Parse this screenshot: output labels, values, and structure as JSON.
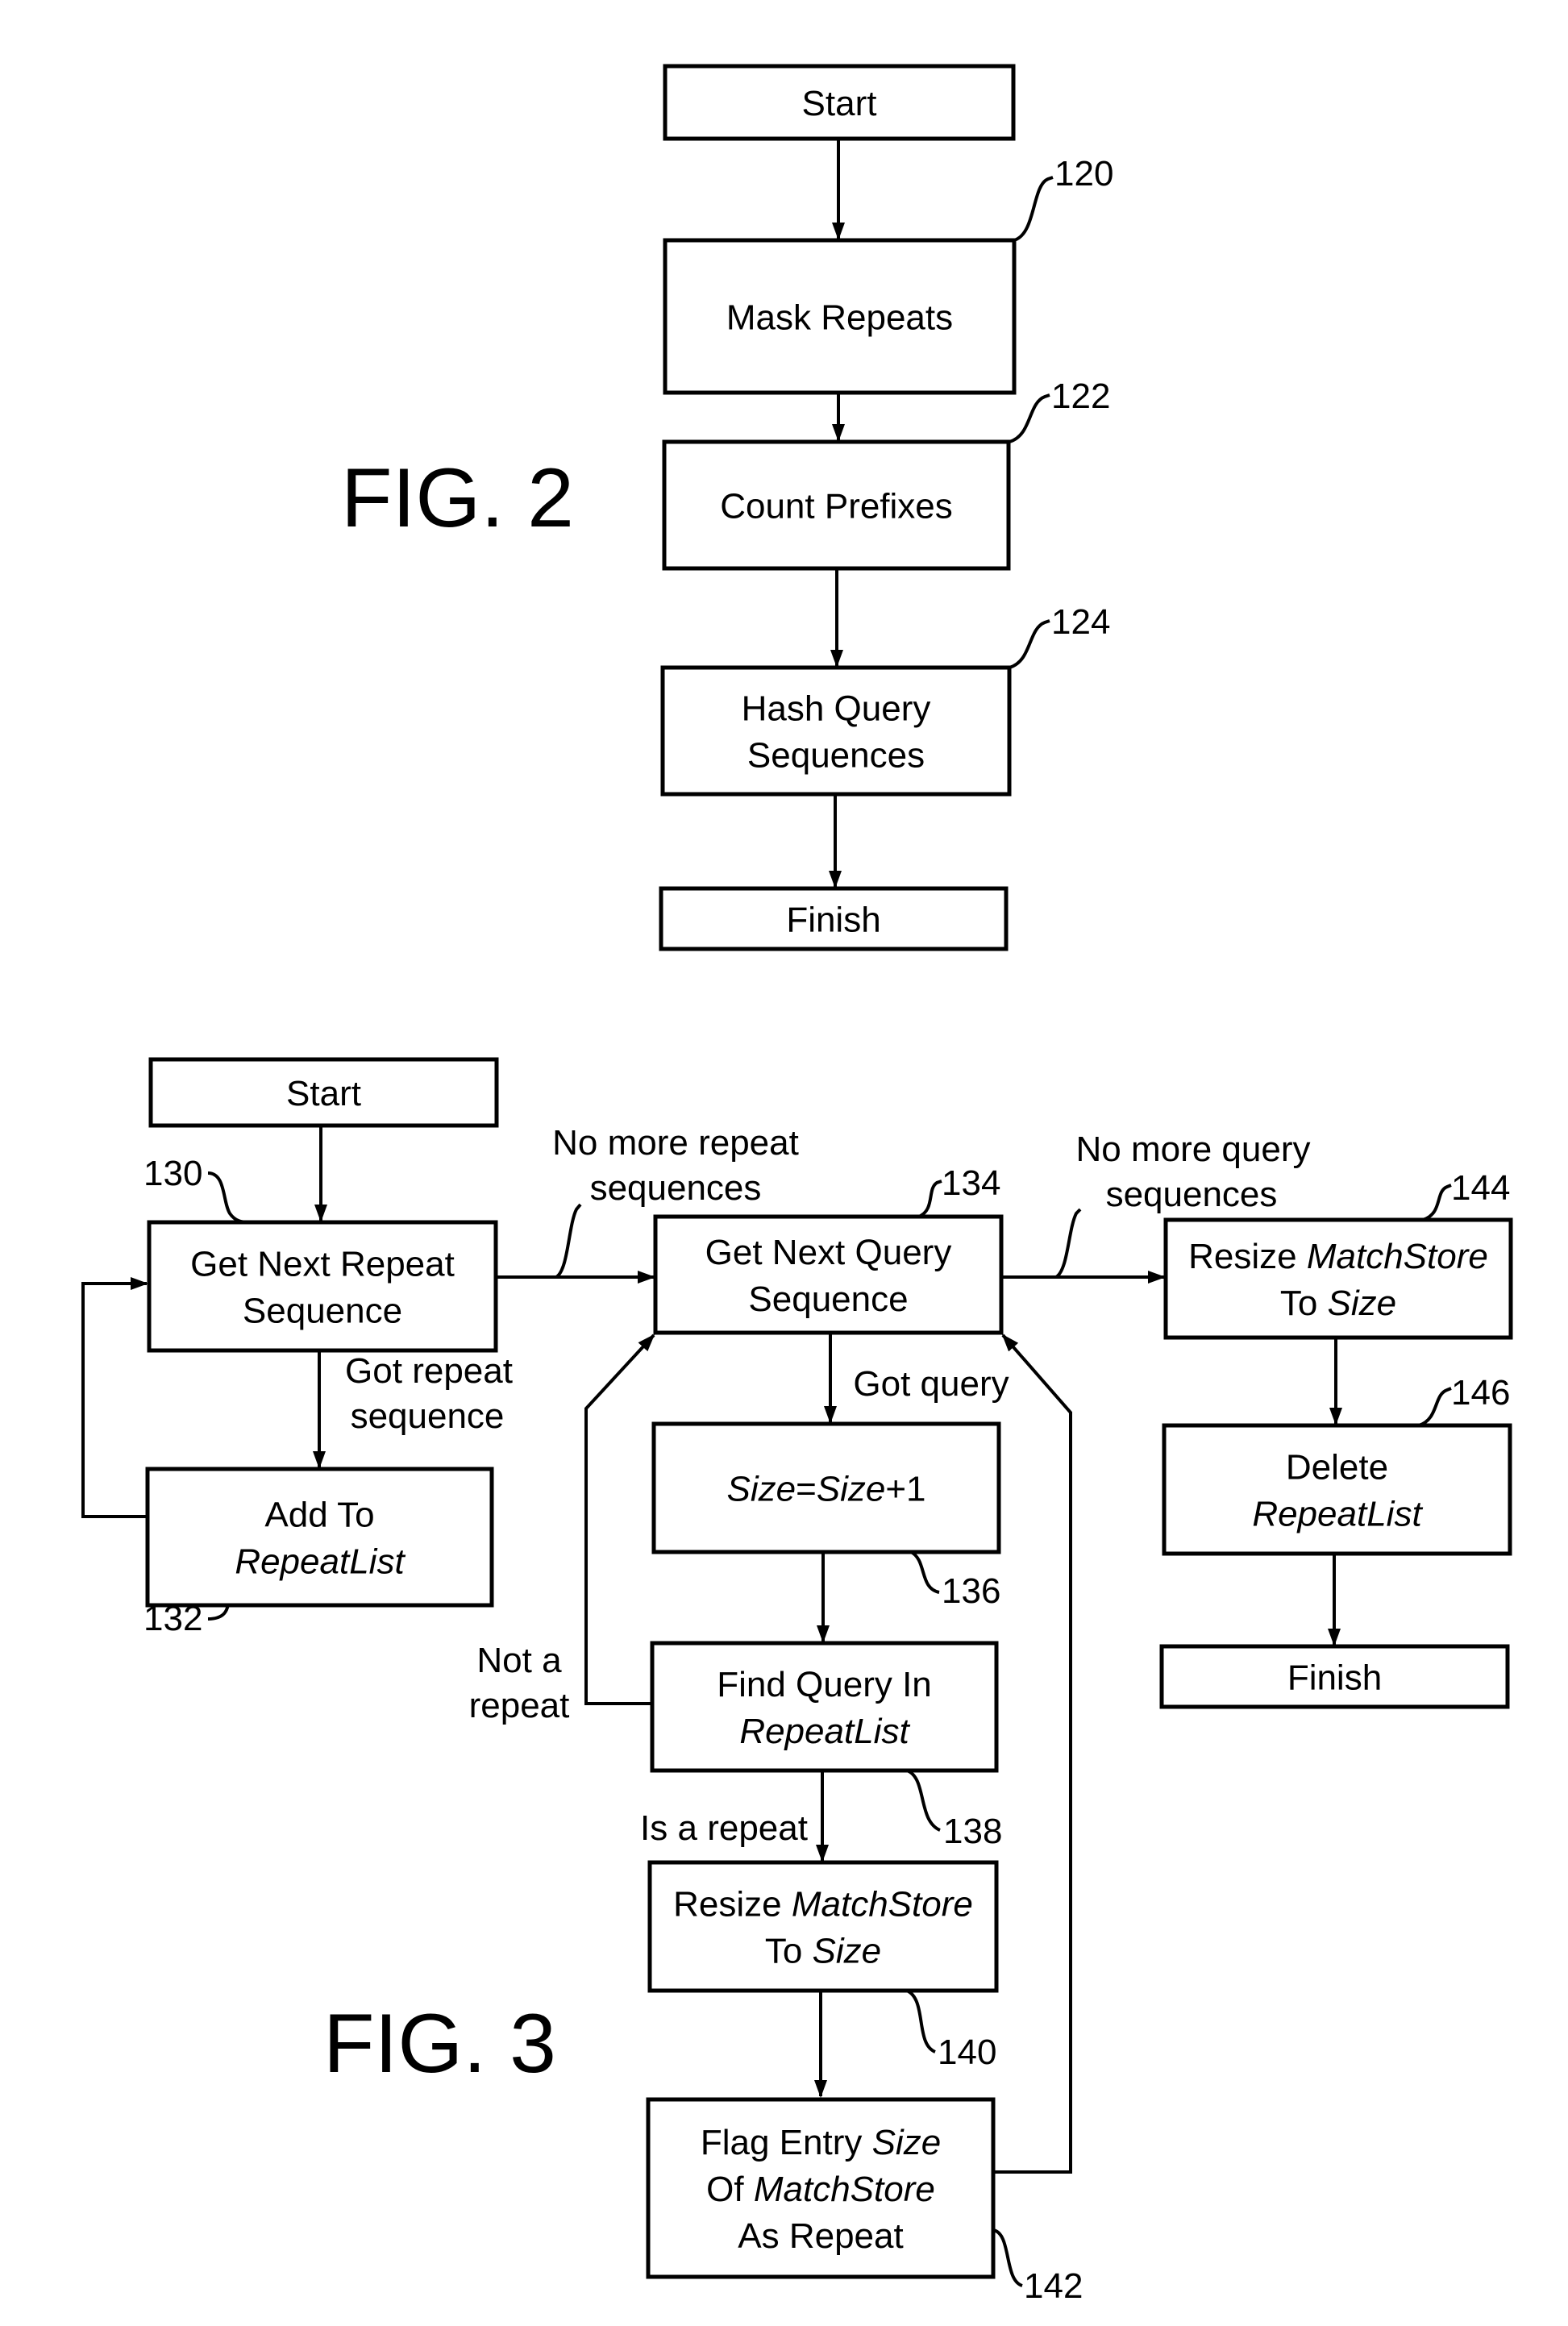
{
  "fig2": {
    "caption": "FIG. 2",
    "nodes": {
      "start": {
        "lines": [
          [
            {
              "t": "Start"
            }
          ]
        ]
      },
      "mask": {
        "ref": "120",
        "lines": [
          [
            {
              "t": "Mask Repeats"
            }
          ]
        ]
      },
      "count": {
        "ref": "122",
        "lines": [
          [
            {
              "t": "Count Prefixes"
            }
          ]
        ]
      },
      "hash": {
        "ref": "124",
        "lines": [
          [
            {
              "t": "Hash Query"
            }
          ],
          [
            {
              "t": "Sequences"
            }
          ]
        ]
      },
      "finish": {
        "lines": [
          [
            {
              "t": "Finish"
            }
          ]
        ]
      }
    }
  },
  "fig3": {
    "caption": "FIG. 3",
    "nodes": {
      "start": {
        "lines": [
          [
            {
              "t": "Start"
            }
          ]
        ]
      },
      "get_repeat": {
        "ref": "130",
        "lines": [
          [
            {
              "t": "Get Next Repeat"
            }
          ],
          [
            {
              "t": "Sequence"
            }
          ]
        ]
      },
      "add_to": {
        "ref": "132",
        "lines": [
          [
            {
              "t": "Add To"
            }
          ],
          [
            {
              "t": "RepeatList",
              "i": true
            }
          ]
        ]
      },
      "get_query": {
        "ref": "134",
        "lines": [
          [
            {
              "t": "Get Next Query"
            }
          ],
          [
            {
              "t": "Sequence"
            }
          ]
        ]
      },
      "size_inc": {
        "ref": "136",
        "lines": [
          [
            {
              "t": "Size",
              "i": true
            },
            {
              "t": "="
            },
            {
              "t": "Size",
              "i": true
            },
            {
              "t": "+1"
            }
          ]
        ]
      },
      "find_query": {
        "ref": "138",
        "lines": [
          [
            {
              "t": "Find Query In"
            }
          ],
          [
            {
              "t": "RepeatList",
              "i": true
            }
          ]
        ]
      },
      "resize_mid": {
        "ref": "140",
        "lines": [
          [
            {
              "t": "Resize "
            },
            {
              "t": "MatchStore",
              "i": true
            }
          ],
          [
            {
              "t": "To "
            },
            {
              "t": "Size",
              "i": true
            }
          ]
        ]
      },
      "flag_entry": {
        "ref": "142",
        "lines": [
          [
            {
              "t": "Flag Entry "
            },
            {
              "t": "Size",
              "i": true
            }
          ],
          [
            {
              "t": "Of "
            },
            {
              "t": "MatchStore",
              "i": true
            }
          ],
          [
            {
              "t": "As Repeat"
            }
          ]
        ]
      },
      "resize_right": {
        "ref": "144",
        "lines": [
          [
            {
              "t": "Resize "
            },
            {
              "t": "MatchStore",
              "i": true
            }
          ],
          [
            {
              "t": "To "
            },
            {
              "t": "Size",
              "i": true
            }
          ]
        ]
      },
      "delete_list": {
        "ref": "146",
        "lines": [
          [
            {
              "t": "Delete"
            }
          ],
          [
            {
              "t": "RepeatList",
              "i": true
            }
          ]
        ]
      },
      "finish": {
        "lines": [
          [
            {
              "t": "Finish"
            }
          ]
        ]
      }
    },
    "edge_labels": {
      "no_more_repeat": [
        "No more repeat",
        "sequences"
      ],
      "got_repeat": [
        "Got repeat",
        "sequence"
      ],
      "no_more_query": [
        "No more query",
        "sequences"
      ],
      "got_query": [
        "Got query"
      ],
      "not_a_repeat": [
        "Not a",
        "repeat"
      ],
      "is_a_repeat": [
        "Is a repeat"
      ]
    }
  }
}
